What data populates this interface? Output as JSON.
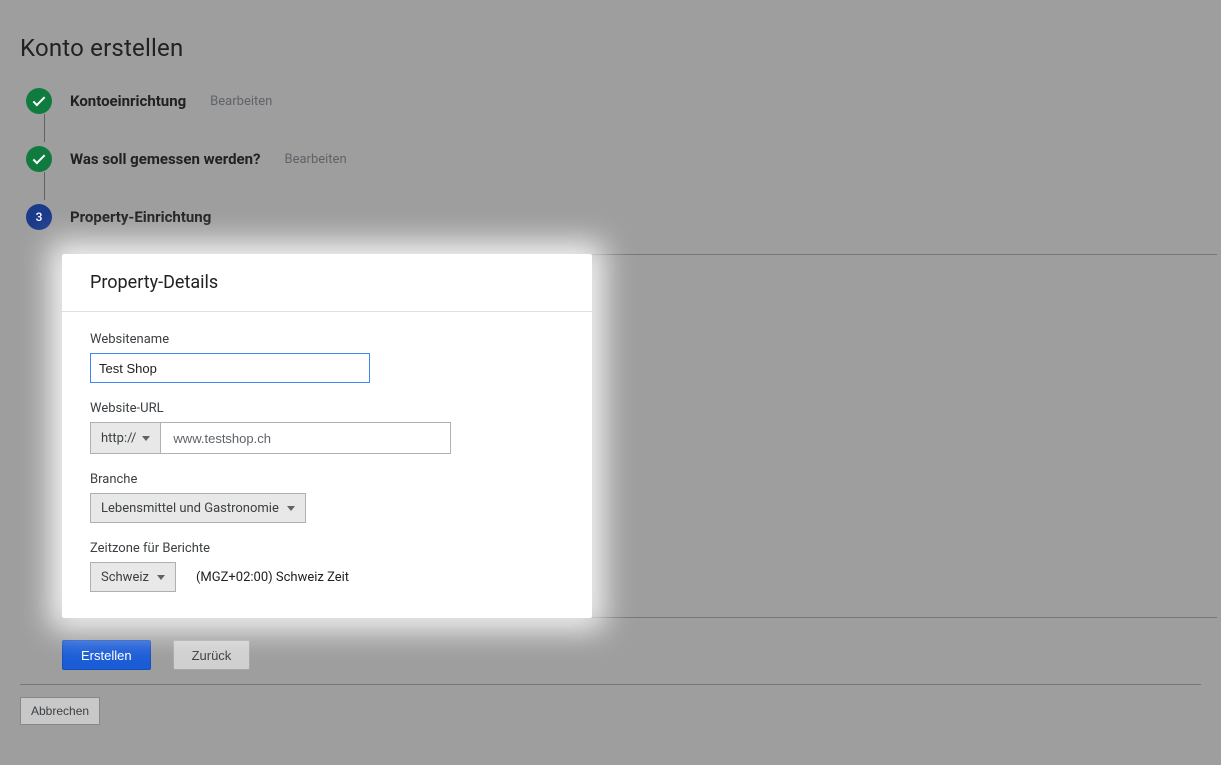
{
  "page": {
    "title": "Konto erstellen",
    "edit_label": "Bearbeiten"
  },
  "steps": {
    "s1": {
      "title": "Kontoeinrichtung"
    },
    "s2": {
      "title": "Was soll gemessen werden?"
    },
    "s3": {
      "number": "3",
      "title": "Property-Einrichtung"
    }
  },
  "card": {
    "title": "Property-Details",
    "website_name": {
      "label": "Websitename",
      "value": "Test Shop"
    },
    "website_url": {
      "label": "Website-URL",
      "protocol": "http://",
      "value": "www.testshop.ch"
    },
    "industry": {
      "label": "Branche",
      "value": "Lebensmittel und Gastronomie"
    },
    "timezone": {
      "label": "Zeitzone für Berichte",
      "country": "Schweiz",
      "zone_text": "(MGZ+02:00) Schweiz Zeit"
    }
  },
  "actions": {
    "create": "Erstellen",
    "back": "Zurück",
    "cancel": "Abbrechen"
  }
}
